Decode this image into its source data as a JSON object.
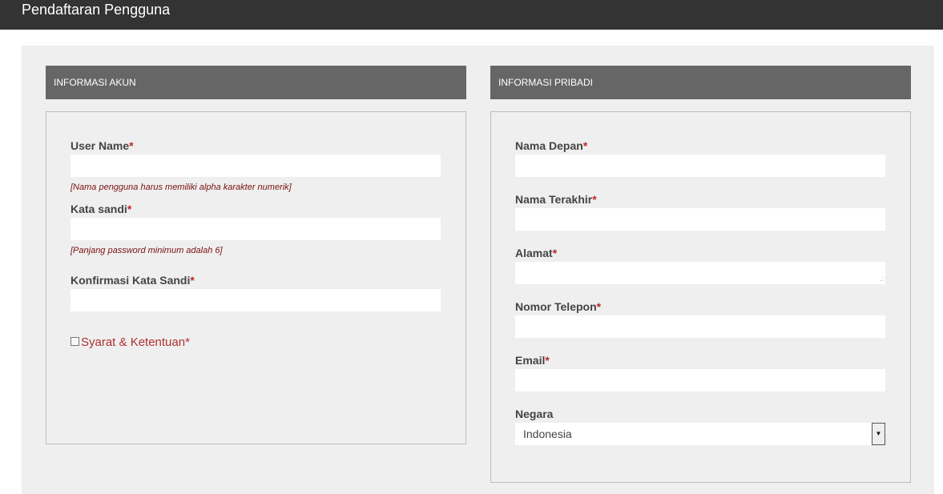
{
  "header": {
    "title": "Pendaftaran Pengguna"
  },
  "account": {
    "section_title": "INFORMASI AKUN",
    "username_label": "User Name",
    "username_hint": "[Nama pengguna harus memiliki alpha karakter numerik]",
    "password_label": "Kata sandi",
    "password_hint": "[Panjang password minimum adalah 6]",
    "confirm_label": "Konfirmasi Kata Sandi",
    "terms_label": "Syarat & Ketentuan",
    "required_mark": "*"
  },
  "personal": {
    "section_title": "INFORMASI PRIBADI",
    "first_name_label": "Nama Depan",
    "last_name_label": "Nama Terakhir",
    "address_label": "Alamat",
    "phone_label": "Nomor Telepon",
    "email_label": "Email",
    "country_label": "Negara",
    "country_value": "Indonesia",
    "required_mark": "*"
  },
  "colors": {
    "topbar": "#333333",
    "section_header": "#666666",
    "panel_bg": "#efefef",
    "required": "#c0262c",
    "hint": "#7a1010"
  },
  "icons": {
    "select_arrow": "dropdown-arrow-icon",
    "resize": "resize-grip-icon"
  }
}
